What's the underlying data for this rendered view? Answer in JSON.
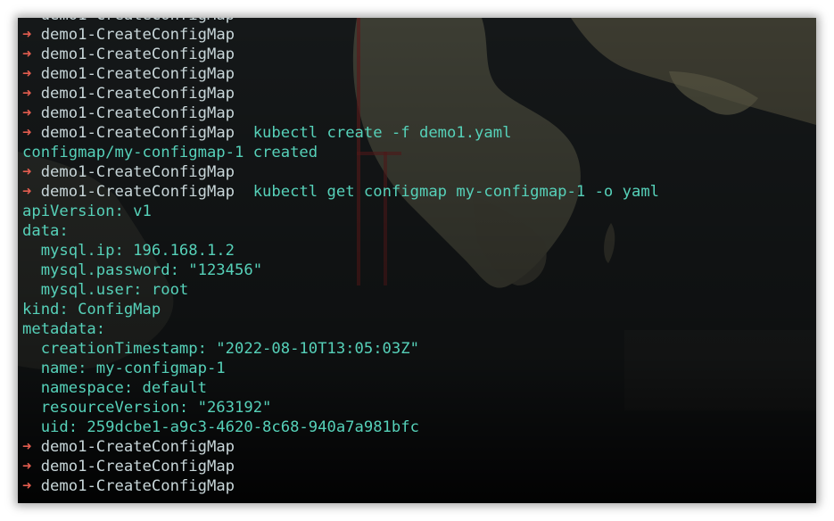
{
  "terminal": {
    "prompt_symbol": "➜",
    "directory": "demo1-CreateConfigMap",
    "lines": [
      {
        "type": "prompt",
        "command": ""
      },
      {
        "type": "prompt",
        "command": ""
      },
      {
        "type": "prompt",
        "command": ""
      },
      {
        "type": "prompt",
        "command": ""
      },
      {
        "type": "prompt",
        "command": ""
      },
      {
        "type": "prompt",
        "command": ""
      },
      {
        "type": "prompt",
        "command": "kubectl create -f demo1.yaml"
      },
      {
        "type": "output",
        "text": "configmap/my-configmap-1 created"
      },
      {
        "type": "prompt",
        "command": ""
      },
      {
        "type": "prompt",
        "command": "kubectl get configmap my-configmap-1 -o yaml"
      },
      {
        "type": "output",
        "text": "apiVersion: v1"
      },
      {
        "type": "output",
        "text": "data:"
      },
      {
        "type": "output",
        "text": "  mysql.ip: 196.168.1.2"
      },
      {
        "type": "output",
        "text": "  mysql.password: \"123456\""
      },
      {
        "type": "output",
        "text": "  mysql.user: root"
      },
      {
        "type": "output",
        "text": "kind: ConfigMap"
      },
      {
        "type": "output",
        "text": "metadata:"
      },
      {
        "type": "output",
        "text": "  creationTimestamp: \"2022-08-10T13:05:03Z\""
      },
      {
        "type": "output",
        "text": "  name: my-configmap-1"
      },
      {
        "type": "output",
        "text": "  namespace: default"
      },
      {
        "type": "output",
        "text": "  resourceVersion: \"263192\""
      },
      {
        "type": "output",
        "text": "  uid: 259dcbe1-a9c3-4620-8c68-940a7a981bfc"
      },
      {
        "type": "prompt",
        "command": ""
      },
      {
        "type": "prompt",
        "command": ""
      },
      {
        "type": "prompt",
        "command": ""
      }
    ]
  },
  "colors": {
    "prompt_arrow": "#e35d4f",
    "directory": "#c8d6d9",
    "command": "#56d1b9",
    "output": "#56d1b9",
    "background": "#0d0f10"
  }
}
